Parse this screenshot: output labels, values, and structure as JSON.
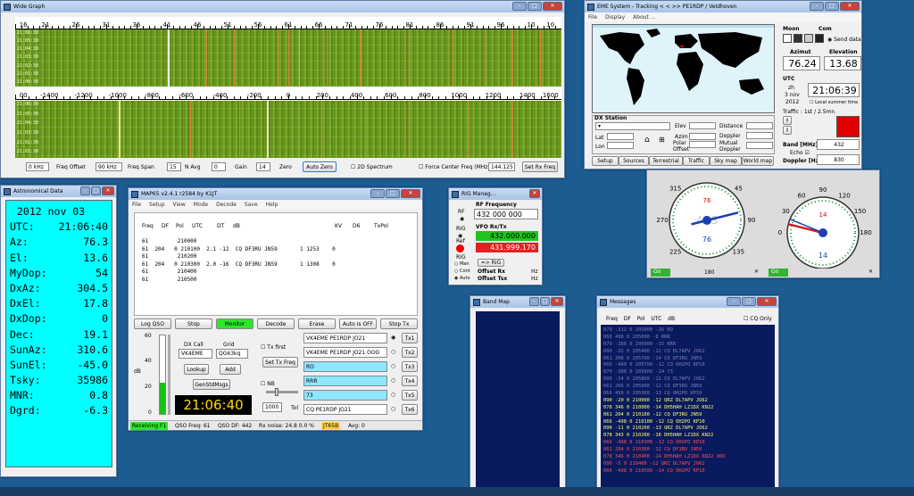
{
  "wide_graph": {
    "title": "Wide Graph",
    "freq_scale": [
      "16",
      "21",
      "26",
      "31",
      "36",
      "41",
      "46",
      "51",
      "56",
      "61",
      "66",
      "71",
      "76",
      "81",
      "86",
      "91",
      "96",
      "10",
      "10"
    ],
    "df_scale": [
      "00",
      "-1400",
      "-1200",
      "-1000",
      "-800",
      "-600",
      "-400",
      "-200",
      "0",
      "200",
      "400",
      "600",
      "800",
      "1000",
      "1200",
      "1400",
      "1600"
    ],
    "times_upper": [
      "21:06:30",
      "21:05:30",
      "21:04:30",
      "21:03:30",
      "21:02:30",
      "21:01:30",
      "21:00:30"
    ],
    "times_lower": [
      "21:06:30",
      "21:05:30",
      "21:04:30",
      "21:03:30",
      "21:02:30",
      "21:01:30"
    ],
    "controls": {
      "zero_khz": "0 kHz",
      "freq_offset": "Freq Offset",
      "span_khz": "90 kHz",
      "freq_span": "Freq Span",
      "navg_val": "15",
      "navg": "N Avg",
      "gain_val": "0",
      "gain": "Gain",
      "zero_val": "14",
      "zero": "Zero",
      "auto_zero": "Auto Zero",
      "spectrum_2d": "2D Spectrum",
      "force_center": "Force Center Freq (MHz)",
      "center_val": "144.125",
      "set_rx": "Set Rx Freq"
    }
  },
  "eme_system": {
    "title": "EME System - Tracking < < >> PE1RDP / Veldhoven",
    "menu": [
      "File",
      "Display",
      "About ..."
    ],
    "moon_label": "Moon",
    "com_label": "Com",
    "send_data": "Send data",
    "azimut_label": "Azimut",
    "elevation_label": "Elevation",
    "azimut": "76.24",
    "elevation": "13.68",
    "utc_label": "UTC",
    "utc_time": "21:06:39",
    "date_day": "3 nov",
    "date_year": "2012",
    "date_zh": "zh",
    "local_summer": "Local summer time",
    "traffic": "Traffic : 1st / 2.5mn",
    "dx_station": "DX Station",
    "lat": "Lat",
    "lon": "Lon",
    "elev": "Elev",
    "azim": "Azim",
    "polar": "Polar",
    "offset": "Offset",
    "distance": "Distance",
    "doppler": "Doppler",
    "mutual": "Mutual",
    "doppler2": "Doppler",
    "band_label": "Band [MHz]",
    "band": "432",
    "echo": "Echo",
    "doppler_hz_label": "Doppler [Hz]",
    "doppler_hz": "830",
    "tabs": [
      "Setup",
      "Sources",
      "Terrestrial",
      "Traffic",
      "Sky map",
      "World map"
    ]
  },
  "gauges": {
    "az": {
      "ticks": [
        "315",
        "45",
        "270",
        "90",
        "225",
        "135",
        "180"
      ],
      "value": "76",
      "needle_deg": 76,
      "center_text": "ARS",
      "go": "Go",
      "scale_180": "180"
    },
    "el": {
      "ticks": [
        "60",
        "90",
        "120",
        "30",
        "150",
        "0",
        "180"
      ],
      "value": "14",
      "needle_deg": 14,
      "go": "Go"
    }
  },
  "astro": {
    "title": "Astronomical Data",
    "rows": [
      {
        "label": "2012 nov 03",
        "value": ""
      },
      {
        "label": "UTC:",
        "value": "21:06:40"
      },
      {
        "label": "Az:",
        "value": "76.3"
      },
      {
        "label": "El:",
        "value": "13.6"
      },
      {
        "label": "MyDop:",
        "value": "54"
      },
      {
        "label": "DxAz:",
        "value": "304.5"
      },
      {
        "label": "DxEl:",
        "value": "17.8"
      },
      {
        "label": "DxDop:",
        "value": "0"
      },
      {
        "label": "Dec:",
        "value": "19.1"
      },
      {
        "label": "SunAz:",
        "value": "310.6"
      },
      {
        "label": "SunEl:",
        "value": "-45.0"
      },
      {
        "label": "Tsky:",
        "value": "35986"
      },
      {
        "label": "MNR:",
        "value": "0.8"
      },
      {
        "label": "Dgrd:",
        "value": "-6.3"
      }
    ]
  },
  "map65": {
    "title": "MAP65    v2.4.1  r2584    by K1JT",
    "menu": [
      "File",
      "Setup",
      "View",
      "Mode",
      "Decode",
      "Save",
      "Help"
    ],
    "columns": [
      "Freq",
      "DF",
      "Pol",
      "UTC",
      "DT",
      "dB",
      "",
      "KV",
      "D6",
      "TxPol"
    ],
    "decodes": [
      "61         210000",
      "61  204   0 210100  2.1 -12  CQ DF3RU JN59       1 1253    0",
      "61         210200",
      "61  204   0 210300  2.0 -16  CQ DF3RU JN59       1 1308    0",
      "61         210400",
      "61         210500"
    ],
    "buttons": {
      "log_qso": "Log QSO",
      "stop": "Stop",
      "monitor": "Monitor",
      "decode": "Decode",
      "erase": "Erase",
      "auto": "Auto is OFF",
      "stop_tx": "Stop Tx"
    },
    "meter_ticks": [
      "60",
      "40",
      "20",
      "0"
    ],
    "db": "dB",
    "dx_call_label": "DX Call",
    "grid_label": "Grid",
    "dx_call": "VK4EME",
    "grid": "QG63kq",
    "lookup": "Lookup",
    "add": "Add",
    "gen_std": "GenStdMsgs",
    "clock": "21:06:40",
    "tx_first": "Tx first",
    "set_tx_freq": "Set Tx Freq",
    "nb": "NB",
    "tol_val": "1000",
    "tol": "Tol",
    "tx_msgs": [
      "VK4EME PE1RDP JO21",
      "VK4EME PE1RDP JO21 OOO",
      "RO",
      "RRR",
      "73",
      "CQ PE1RDP JO21"
    ],
    "tx_btns": [
      "Tx1",
      "Tx2",
      "Tx3",
      "Tx4",
      "Tx5",
      "Tx6"
    ],
    "status": {
      "receiving": "Receiving F1",
      "qso_freq": "QSO Freq:  61",
      "qso_df": "QSO DF:  442",
      "rx_noise": "Rx noise:  24.8    0.0 %",
      "mode": "JT65B",
      "avg": "Avg: 0"
    }
  },
  "rig": {
    "title": "RIG Manag...",
    "rf_label": "RF",
    "rf_freq_label": "RF Frequency",
    "rf_freq": "432   000 000",
    "rig_label": "RIG",
    "vfo_label": "VFO Rx/Tx",
    "ref_label": "Ref",
    "vfo_rx": "432.000.000",
    "vfo_tx": "431.999.170",
    "rig_btn": "=> RIG",
    "offset_rx": "Offset Rx",
    "offset_tx": "Offset Tsx",
    "hz": "Hz",
    "man": "Man",
    "cont": "Cont",
    "auto": "Auto"
  },
  "band_map": {
    "title": "Band Map"
  },
  "messages": {
    "title": "Messages",
    "columns": "Freq  DF  Pol  UTC  dB",
    "cq_only": "CQ Only",
    "lines": [
      {
        "t": "079  -312    0  205000 -26  RO",
        "c": "#7f7fb0"
      },
      {
        "t": "066  498    0  205000  -8  RRR",
        "c": "#7f7fb0"
      },
      {
        "t": "079  -386    0  205000 -15  RRR",
        "c": "#7f7fb0"
      },
      {
        "t": "090  -32    0  205400 -12  CQ DL7APV JO62",
        "c": "#7f7fb0"
      },
      {
        "t": "061  208    0  205700 -14  CQ DF3RU JN59",
        "c": "#7f7fb0"
      },
      {
        "t": "066  -499    0  205700 -12  CQ OH2PO KP10",
        "c": "#7f7fb0"
      },
      {
        "t": "079  -388    0  205800 -14  73",
        "c": "#7f7fb0"
      },
      {
        "t": "090  -24    0  205800 -12  CQ DL7APV JO62",
        "c": "#7f7fb0"
      },
      {
        "t": "061  206    0  205900 -12  CQ DF3RU JN59",
        "c": "#7f7fb0"
      },
      {
        "t": "066  499    0  205900 -13  CQ OH2PO KP10",
        "c": "#7f7fb0"
      },
      {
        "t": "090  -20    0  210000 -12  QRZ DL7APV JO62",
        "c": "#ffff66"
      },
      {
        "t": "078  346    0  210000 -14  DH5HAH LZ1DX KN22",
        "c": "#ffff66"
      },
      {
        "t": "061  204    0  210100 -12  CQ DF3RU JN59",
        "c": "#ffff66"
      },
      {
        "t": "066  -498    0  210100 -12  CQ OH2PO KP10",
        "c": "#ffff66"
      },
      {
        "t": "090  -11    0  210200 -13  QRZ DL7APV JO62",
        "c": "#ffff66"
      },
      {
        "t": "078  343    0  210200 -16  DH5HAH LZ1DX KN22",
        "c": "#ffff66"
      },
      {
        "t": "066  -498    0  210300 -12  CQ OH2PO KP10",
        "c": "#ff5050"
      },
      {
        "t": "061  204    0  210300 -12  CQ DF3RU JN59",
        "c": "#ff5050"
      },
      {
        "t": "078  346    0  210400 -14  DH5HAH LZ1DX KN22 OOO",
        "c": "#ff5050"
      },
      {
        "t": "090  -5    0  210400 -12  QRZ DL7APV JO62",
        "c": "#ff5050"
      },
      {
        "t": "066  -498    0  210500 -14  CQ OH2PO KP10",
        "c": "#ff5050"
      }
    ]
  }
}
